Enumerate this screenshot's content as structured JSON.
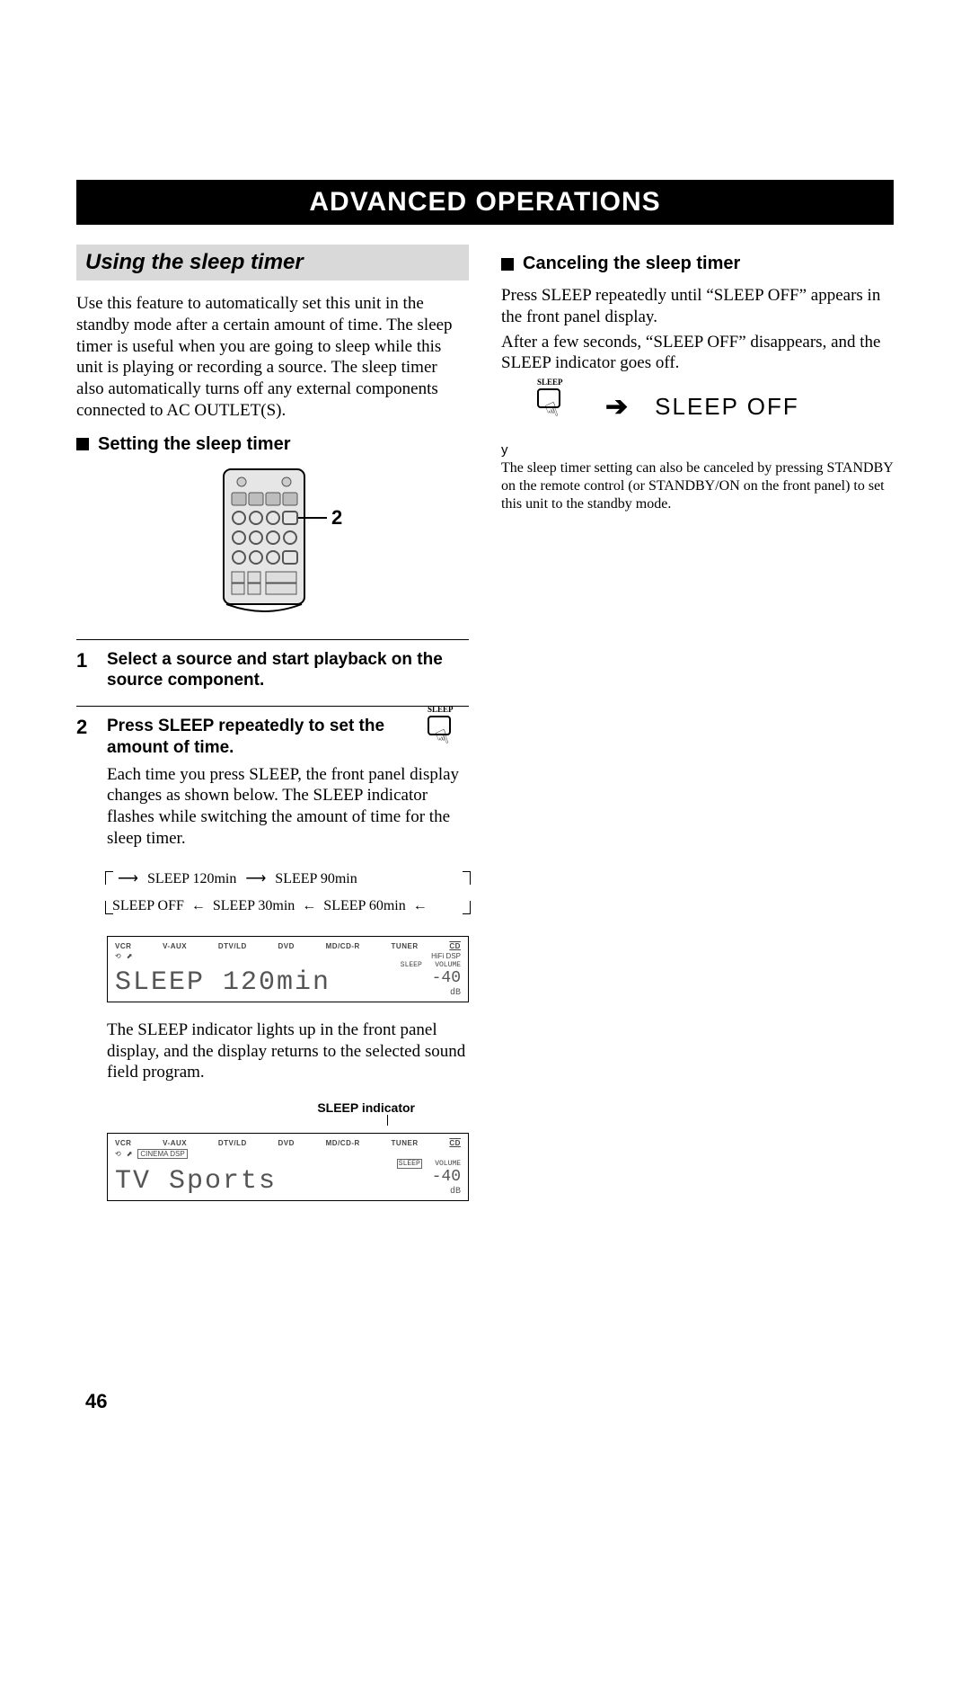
{
  "banner": "ADVANCED OPERATIONS",
  "section_title": "Using the sleep timer",
  "intro": "Use this feature to automatically set this unit in the standby mode after a certain amount of time. The sleep timer is useful when you are going to sleep while this unit is playing or recording a source. The sleep timer also automatically turns off any external components connected to AC OUTLET(S).",
  "setting_head": "Setting the sleep timer",
  "remote_callout": "2",
  "steps": [
    {
      "num": "1",
      "title": "Select a source and start playback on the source component.",
      "body": ""
    },
    {
      "num": "2",
      "title": "Press SLEEP repeatedly to set the amount of time.",
      "body": "Each time you press SLEEP, the front panel display changes as shown below. The SLEEP indicator flashes while switching the amount of time for the sleep timer."
    }
  ],
  "cycle": {
    "a": "SLEEP  120min",
    "b": "SLEEP  90min",
    "c": "SLEEP  OFF",
    "d": "SLEEP  30min",
    "e": "SLEEP  60min"
  },
  "panel_sources": [
    "VCR",
    "V-AUX",
    "DTV/LD",
    "DVD",
    "MD/CD-R",
    "TUNER",
    "CD"
  ],
  "panel_tags": {
    "hifi": "HiFi DSP",
    "cinema": "CINEMA DSP",
    "volume": "VOLUME",
    "sleep": "SLEEP"
  },
  "panel1_text": "SLEEP 120min",
  "panel_db": "-40",
  "after_panel1": "The SLEEP indicator lights up in the front panel display, and the display returns to the selected sound field program.",
  "sleep_indicator_label": "SLEEP indicator",
  "panel2_text": "TV Sports",
  "cancel_head": "Canceling the sleep timer",
  "cancel_body1": "Press SLEEP repeatedly until “SLEEP OFF” appears in the front panel display.",
  "cancel_body2": "After a few seconds, “SLEEP OFF” disappears, and the SLEEP indicator goes off.",
  "sleep_btn_label": "SLEEP",
  "sleep_off_text": "SLEEP OFF",
  "note_marker": "y",
  "note_body": "The sleep timer setting can also be canceled by pressing STANDBY on the remote control (or STANDBY/ON on the front panel) to set this unit to the standby mode.",
  "page_number": "46"
}
